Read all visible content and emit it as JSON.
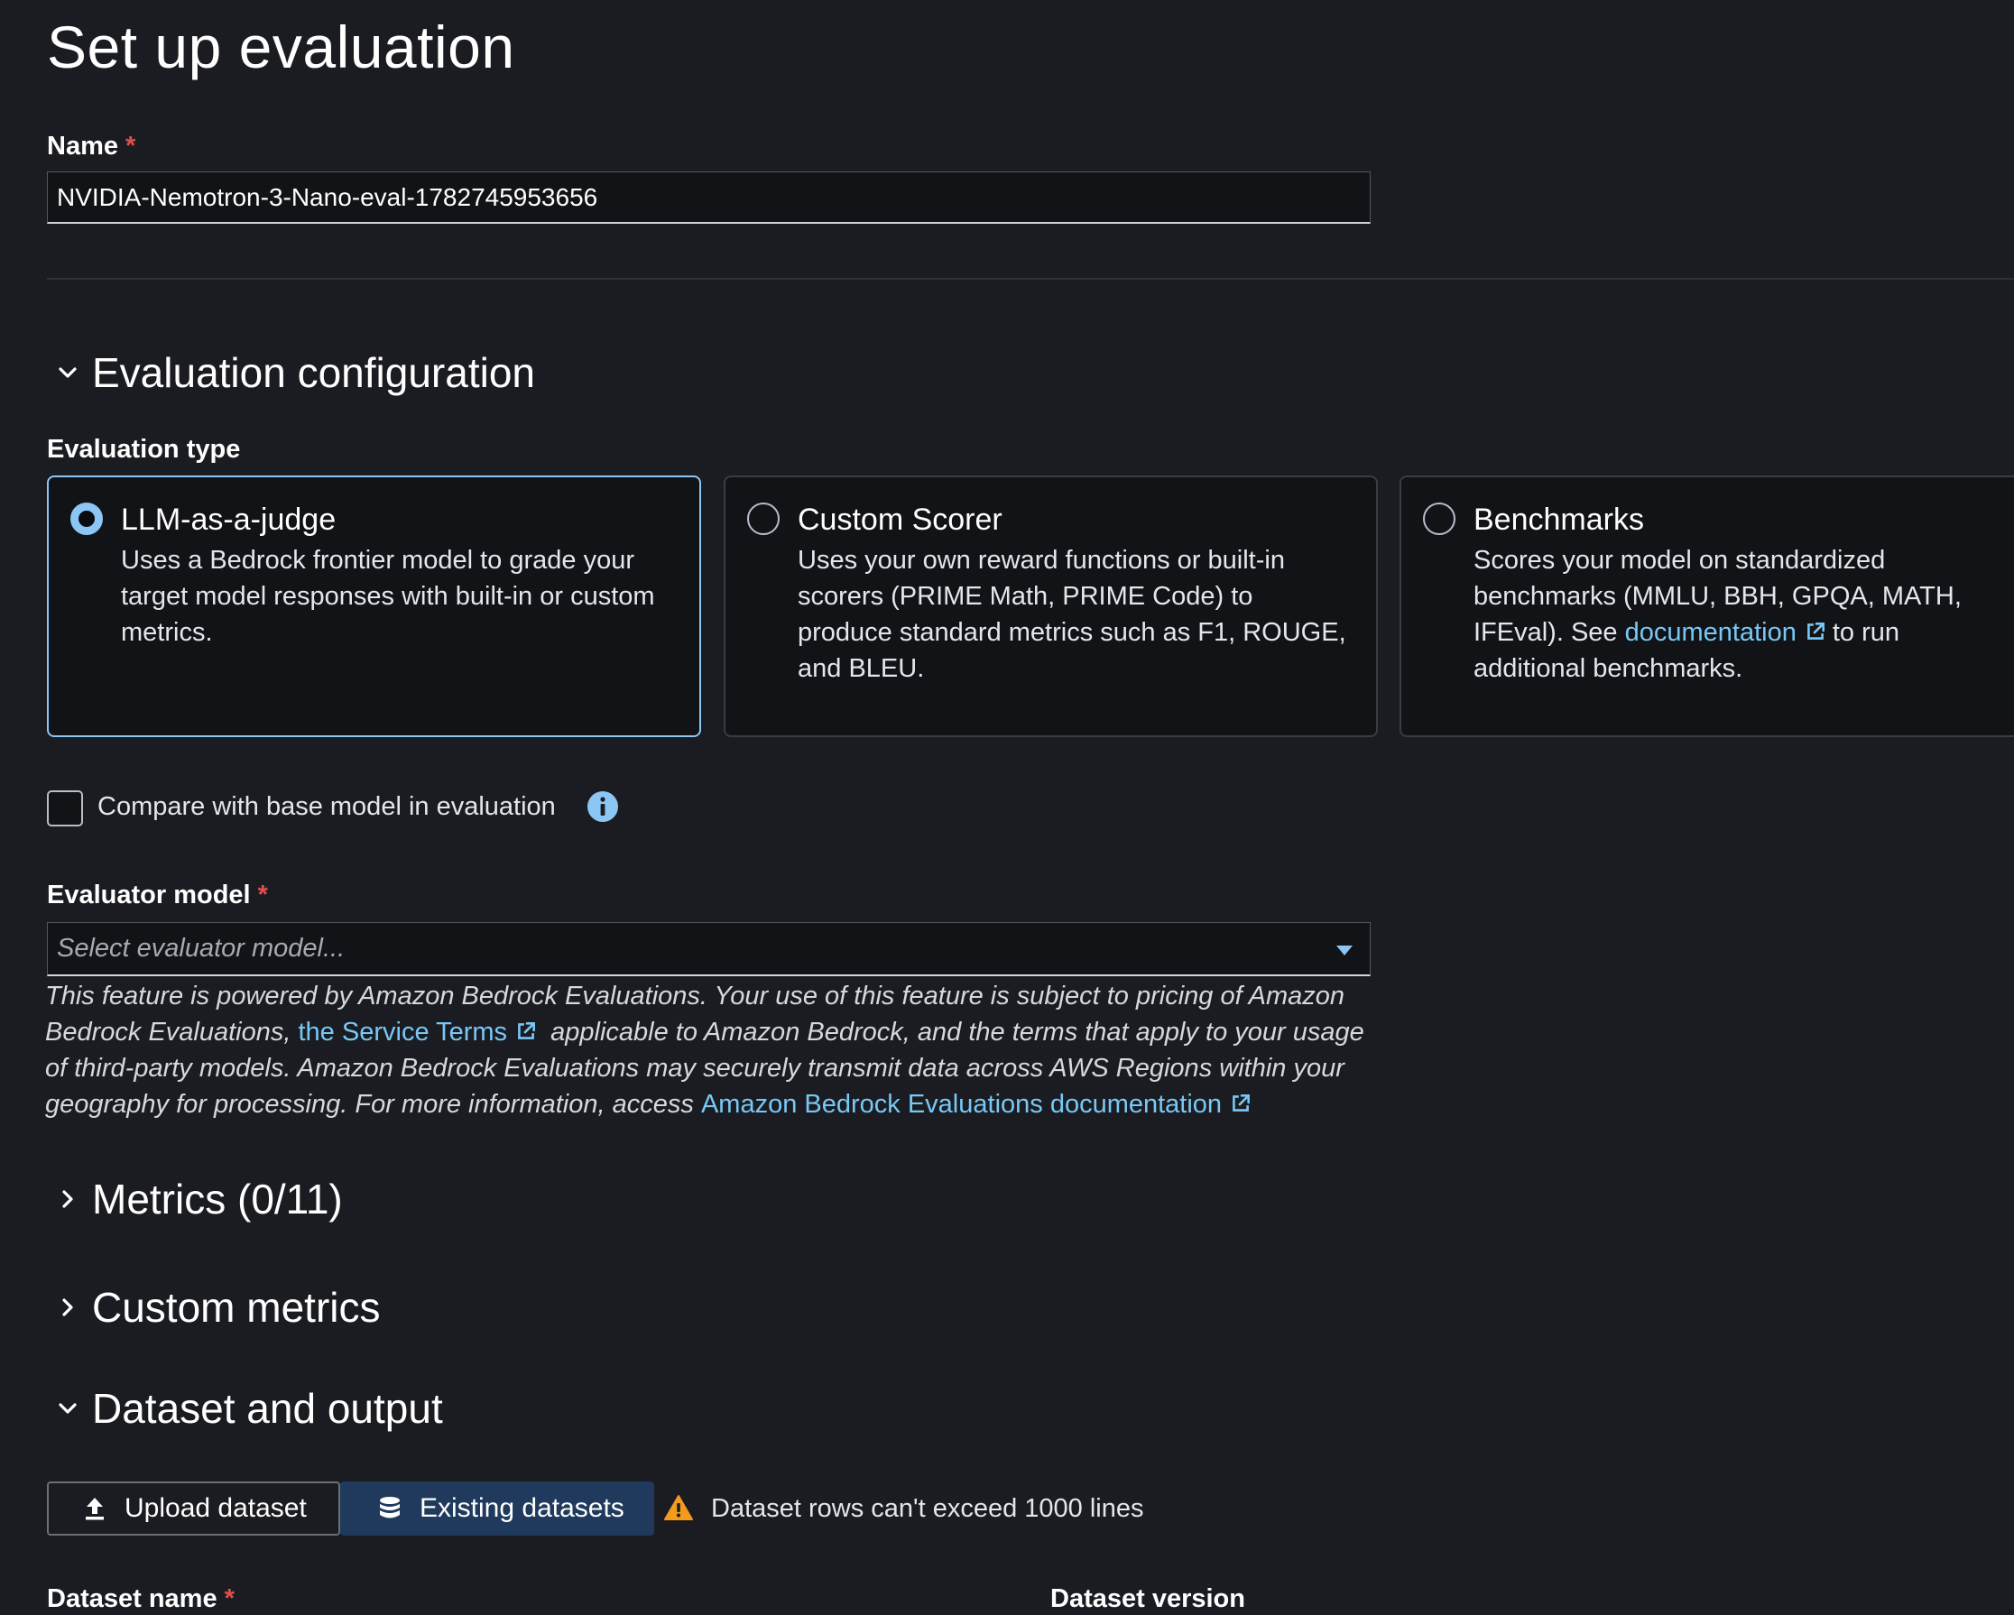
{
  "page": {
    "title": "Set up evaluation"
  },
  "name_field": {
    "label": "Name",
    "required_mark": "*",
    "value": "NVIDIA-Nemotron-3-Nano-eval-1782745953656"
  },
  "sections": {
    "evaluation_config": {
      "title": "Evaluation configuration",
      "expanded": true
    },
    "metrics": {
      "title": "Metrics (0/11)",
      "expanded": false
    },
    "custom_metrics": {
      "title": "Custom metrics",
      "expanded": false
    },
    "dataset_output": {
      "title": "Dataset and output",
      "expanded": true
    }
  },
  "evaluation_type": {
    "label": "Evaluation type",
    "selected": "llm-as-a-judge",
    "options": [
      {
        "title": "LLM-as-a-judge",
        "description": "Uses a Bedrock frontier model to grade your target model responses with built-in or custom metrics."
      },
      {
        "title": "Custom Scorer",
        "description": "Uses your own reward functions or built-in scorers (PRIME Math, PRIME Code) to produce standard metrics such as F1, ROUGE, and BLEU."
      },
      {
        "title": "Benchmarks",
        "description_before": "Scores your model on standardized benchmarks (MMLU, BBH, GPQA, MATH, IFEval). See",
        "link": "documentation",
        "description_after": "to run additional benchmarks."
      }
    ]
  },
  "compare_checkbox": {
    "label": "Compare with base model in evaluation",
    "checked": false
  },
  "evaluator_model": {
    "label": "Evaluator model",
    "required_mark": "*",
    "placeholder": "Select evaluator model...",
    "disclaimer_part1": "This feature is powered by Amazon Bedrock Evaluations. Your use of this feature is subject to pricing of Amazon Bedrock Evaluations,",
    "disclaimer_link1": "the Service Terms",
    "disclaimer_part2": "applicable to Amazon Bedrock, and the terms that apply to your usage of third-party models. Amazon Bedrock Evaluations may securely transmit data across AWS Regions within your geography for processing. For more information, access",
    "disclaimer_link2": "Amazon Bedrock Evaluations documentation"
  },
  "dataset": {
    "upload_label": "Upload dataset",
    "existing_label": "Existing datasets",
    "active_tab": "existing",
    "warning": "Dataset rows can't exceed 1000 lines",
    "name_label": "Dataset name",
    "name_required_mark": "*",
    "version_label": "Dataset version"
  },
  "colors": {
    "accent": "#8cc6f5",
    "link": "#78c8f5",
    "required": "#e0504b",
    "warning": "#f29b1d",
    "background": "#1b1c22"
  }
}
